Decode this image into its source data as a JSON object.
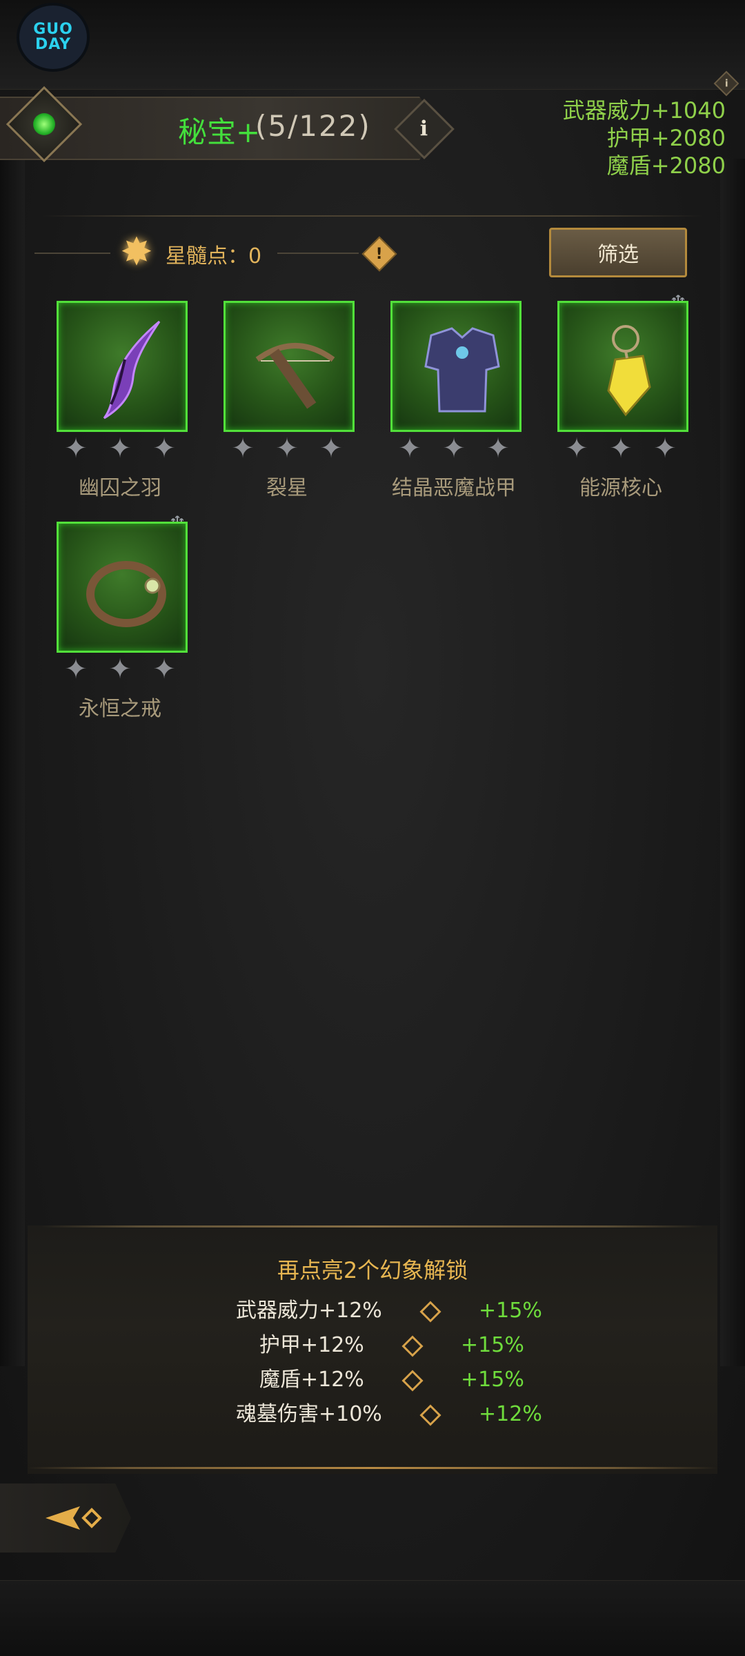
{
  "logo": {
    "text_line1": "GUO",
    "text_line2": "DAY"
  },
  "header": {
    "title": "秘宝+",
    "count": "(5/122)",
    "info_label": "i"
  },
  "stats": {
    "weapon_power": "武器威力+1040",
    "armor": "护甲+2080",
    "magic_shield": "魔盾+2080",
    "corner_info": "i"
  },
  "marrow": {
    "label": "星髓点：0",
    "info_label": "!"
  },
  "filter": {
    "label": "筛选"
  },
  "items": [
    {
      "name": "幽囚之羽",
      "stars": 3,
      "icon": "purple-blade-icon"
    },
    {
      "name": "裂星",
      "stars": 3,
      "icon": "crossbow-icon"
    },
    {
      "name": "结晶恶魔战甲",
      "stars": 3,
      "icon": "armor-icon"
    },
    {
      "name": "能源核心",
      "stars": 3,
      "icon": "energy-core-icon"
    },
    {
      "name": "永恒之戒",
      "stars": 3,
      "icon": "ring-icon"
    }
  ],
  "unlock": {
    "title": "再点亮2个幻象解锁",
    "rows": [
      {
        "label": "武器威力+12%",
        "next": "+15%"
      },
      {
        "label": "护甲+12%",
        "next": "+15%"
      },
      {
        "label": "魔盾+12%",
        "next": "+15%"
      },
      {
        "label": "魂墓伤害+10%",
        "next": "+12%"
      }
    ]
  },
  "colors": {
    "accent_green": "#43df3c",
    "stat_green": "#8fd04a",
    "gold": "#e1b35b",
    "item_border": "#52e03a"
  }
}
